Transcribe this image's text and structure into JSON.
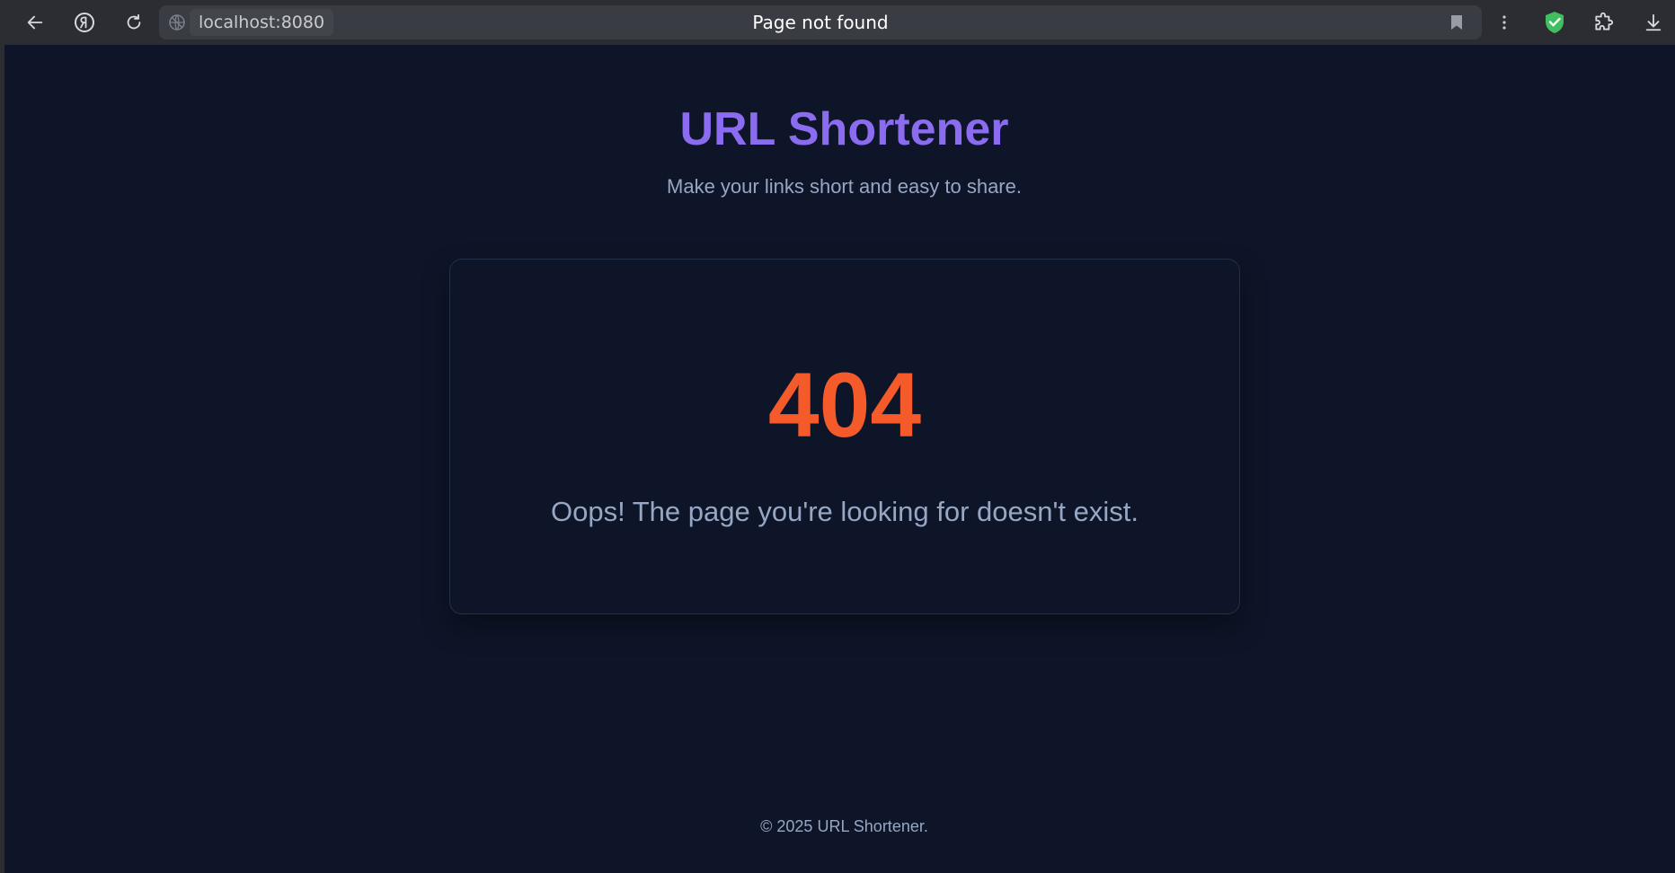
{
  "browser": {
    "address": {
      "host": "localhost:8080",
      "page_title": "Page not found"
    },
    "icons": {
      "back": "arrow-left-icon",
      "home": "yandex-icon",
      "reload": "reload-icon",
      "site_info": "globe-icon",
      "bookmark": "bookmark-icon",
      "menu": "kebab-menu-icon",
      "protect": "shield-check-icon",
      "extensions": "puzzle-icon",
      "downloads": "download-icon"
    },
    "colors": {
      "chrome": "#2b2d33",
      "address_bar": "#3a3c43",
      "shield": "#3fbf5e"
    }
  },
  "page": {
    "title": "URL Shortener",
    "subtitle": "Make your links short and easy to share.",
    "error": {
      "code": "404",
      "message": "Oops! The page you're looking for doesn't exist."
    },
    "footer": "© 2025 URL Shortener.",
    "colors": {
      "background": "#0e1528",
      "title": "#8b6cf0",
      "error_code": "#f45a2a",
      "muted_text": "#97a7c3",
      "card_border": "#23304a"
    }
  }
}
